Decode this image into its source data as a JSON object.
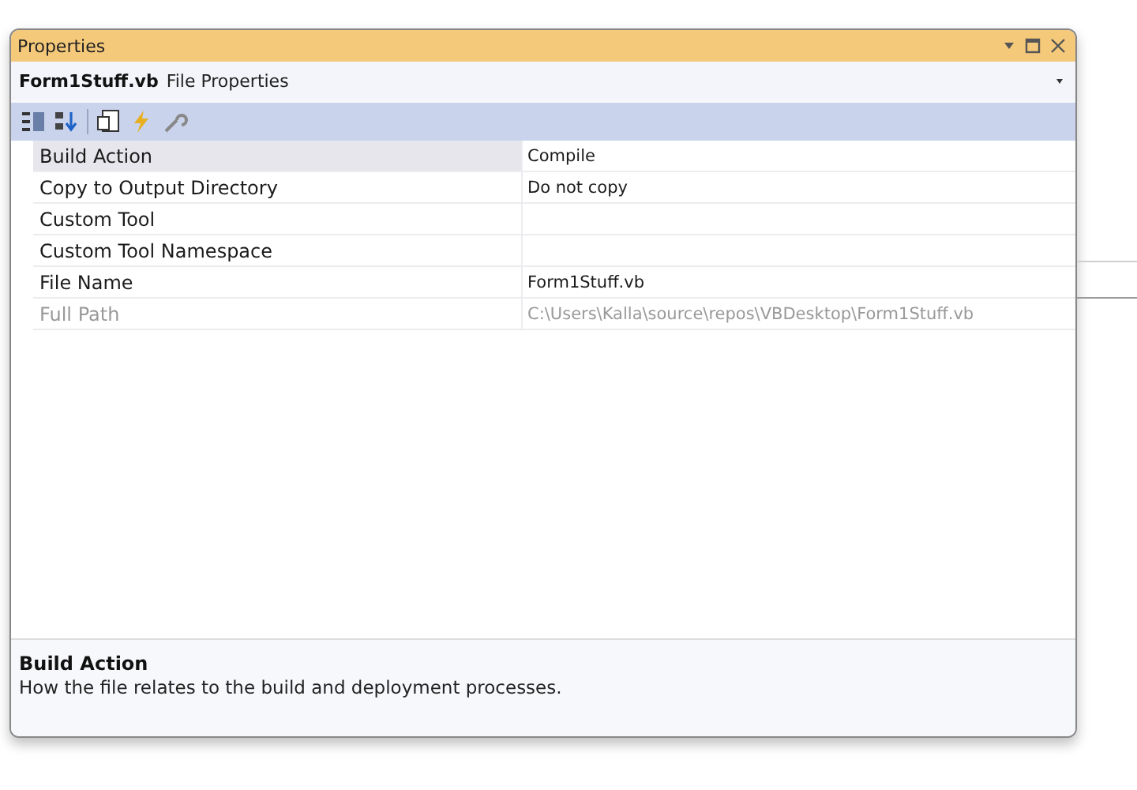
{
  "window": {
    "title": "Properties"
  },
  "object": {
    "name": "Form1Stuff.vb",
    "type": "File Properties"
  },
  "properties": [
    {
      "name": "Build Action",
      "value": "Compile",
      "selected": true,
      "disabled": false
    },
    {
      "name": "Copy to Output Directory",
      "value": "Do not copy",
      "selected": false,
      "disabled": false
    },
    {
      "name": "Custom Tool",
      "selected": false,
      "disabled": false
    },
    {
      "name": "Custom Tool Namespace",
      "selected": false,
      "disabled": false
    },
    {
      "name": "File Name",
      "value": "Form1Stuff.vb",
      "selected": false,
      "disabled": false
    },
    {
      "name": "Full Path",
      "value": "C:\\Users\\Kalla\\source\\repos\\VBDesktop\\Form1Stuff.vb",
      "selected": false,
      "disabled": true
    }
  ],
  "description": {
    "title": "Build Action",
    "text": "How the file relates to the build and deployment processes."
  }
}
